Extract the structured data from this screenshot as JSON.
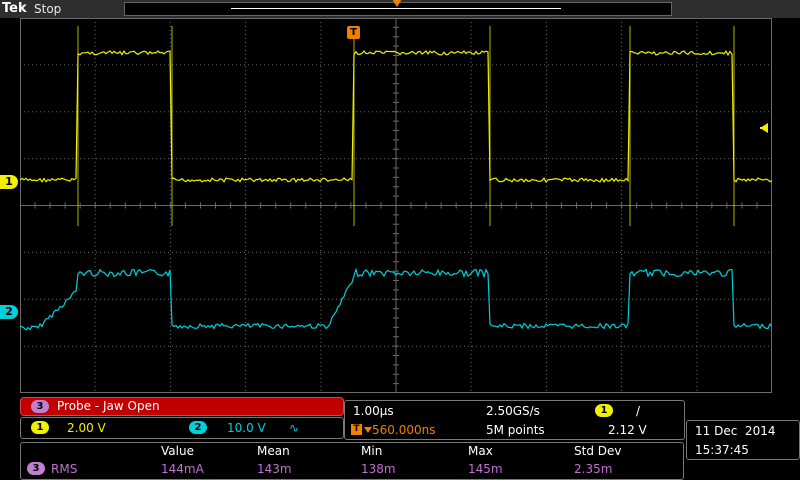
{
  "header": {
    "brand": "Tek",
    "state": "Stop"
  },
  "markers": {
    "ch1": "1",
    "ch2": "2",
    "trigger": "T"
  },
  "probe_label": {
    "channel": "3",
    "text": "Probe - Jaw Open"
  },
  "channels": {
    "ch1": {
      "number": "1",
      "scale": "2.00 V"
    },
    "ch2": {
      "number": "2",
      "scale": "10.0 V",
      "coupling_symbol": "∿"
    }
  },
  "timebase": {
    "time_per_div": "1.00µs",
    "sample_rate": "2.50GS/s",
    "trigger_delay": "560.000ns",
    "record_length": "5M points",
    "trigger_channel": "1",
    "trigger_slope": "/",
    "trigger_level": "2.12 V"
  },
  "datetime": {
    "date": "11 Dec  2014",
    "time": "15:37:45"
  },
  "measurements": {
    "headers": [
      "Value",
      "Mean",
      "Min",
      "Max",
      "Std Dev"
    ],
    "rows": [
      {
        "channel": "3",
        "type": "RMS",
        "value": "144mA",
        "mean": "143m",
        "min": "138m",
        "max": "145m",
        "std_dev": "2.35m"
      }
    ]
  },
  "colors": {
    "ch1": "#f0f000",
    "ch2": "#00d0d8",
    "ch3": "#c070d0",
    "trigger": "#f08000",
    "grid": "#6a6a6a",
    "background": "#000000"
  }
}
